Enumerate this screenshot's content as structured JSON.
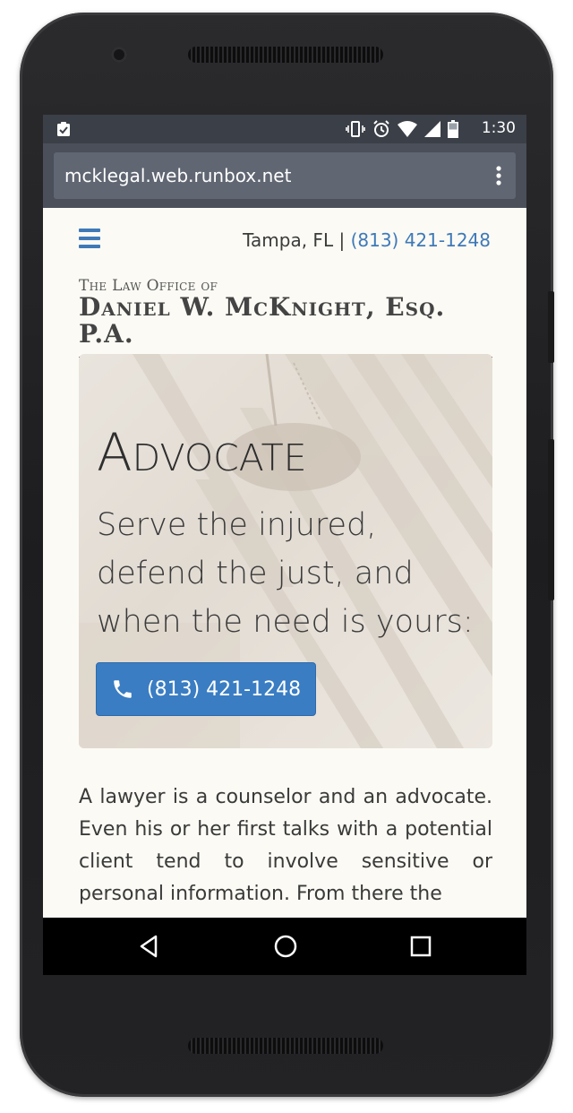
{
  "statusbar": {
    "time": "1:30"
  },
  "browser": {
    "url": "mcklegal.web.runbox.net"
  },
  "header": {
    "location": "Tampa, FL",
    "separator": "|",
    "phone": "(813) 421-1248"
  },
  "brand": {
    "subtitle": "The Law Office of",
    "name": "Daniel W. McKnight, Esq. P.A."
  },
  "hero": {
    "kicker": "Advocate",
    "tagline": "Serve the injured, defend the just, and when the need is yours:",
    "call_button_label": "(813) 421-1248"
  },
  "body": {
    "paragraph": "A lawyer is a counselor and an advocate. Even his or her first talks with a potential client tend to involve sensitive or personal information. From there the"
  },
  "colors": {
    "accent": "#3f79b8",
    "button": "#3a7dc3",
    "page_bg": "#fbfaf4",
    "status_bar": "#3b3f47"
  }
}
